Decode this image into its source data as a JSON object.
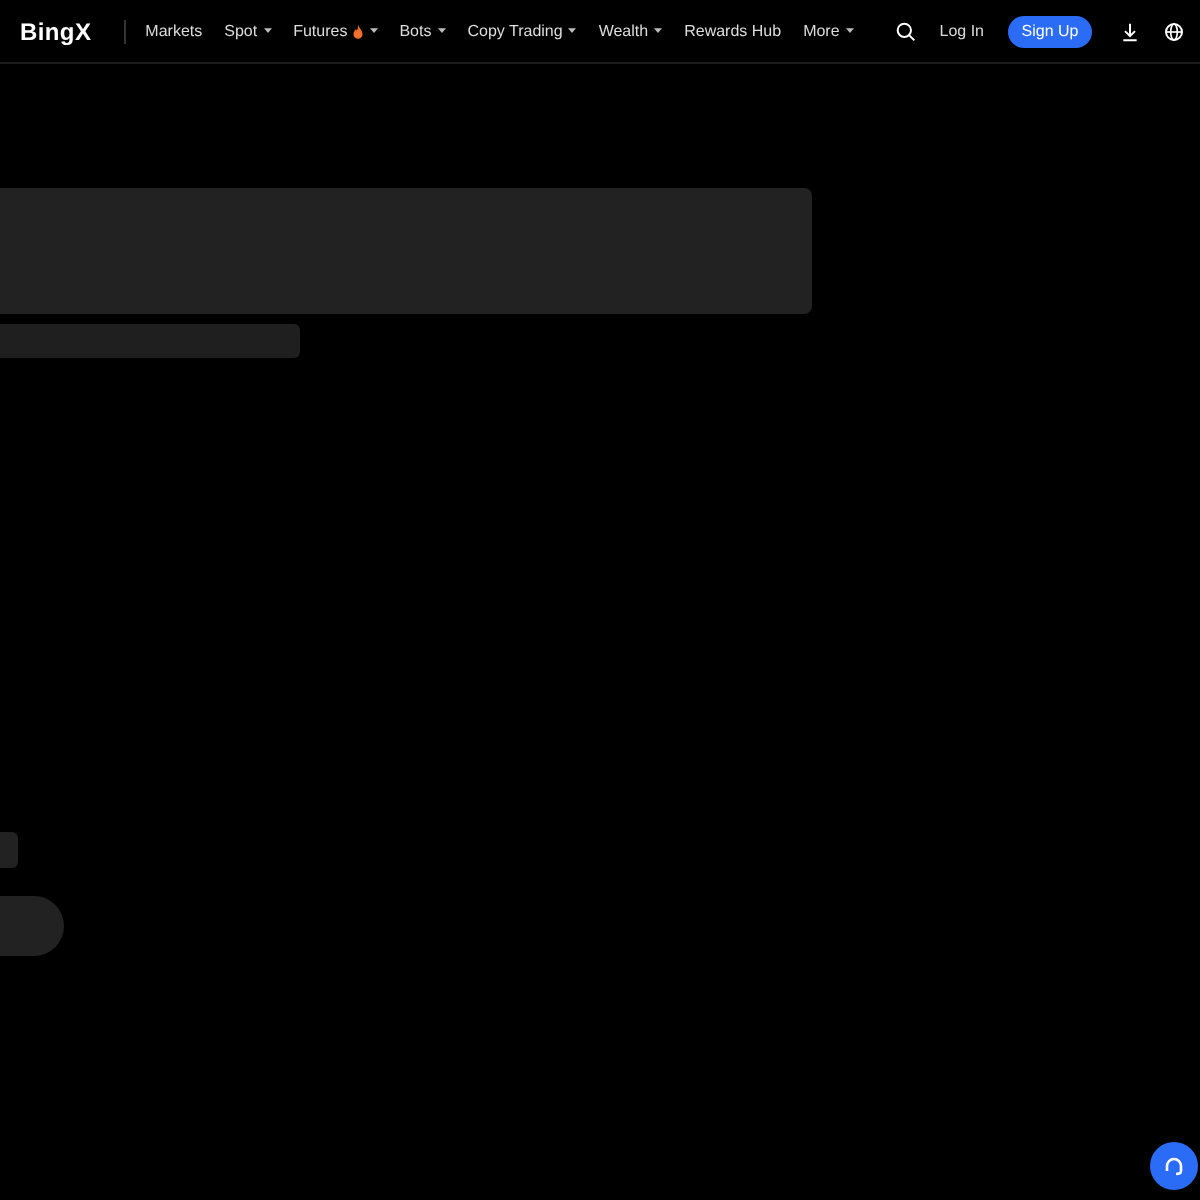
{
  "header": {
    "logo": "BingX",
    "nav": [
      {
        "label": "Markets",
        "kind": "link",
        "hot": false
      },
      {
        "label": "Spot",
        "kind": "dropdown",
        "hot": false
      },
      {
        "label": "Futures",
        "kind": "dropdown",
        "hot": true
      },
      {
        "label": "Bots",
        "kind": "dropdown",
        "hot": false
      },
      {
        "label": "Copy Trading",
        "kind": "dropdown",
        "hot": false
      },
      {
        "label": "Wealth",
        "kind": "dropdown",
        "hot": false
      },
      {
        "label": "Rewards Hub",
        "kind": "link",
        "hot": false
      },
      {
        "label": "More",
        "kind": "dropdown",
        "hot": false
      }
    ],
    "login": "Log In",
    "signup": "Sign Up"
  },
  "placeholders": [
    {
      "kind": "block"
    },
    {
      "kind": "line"
    },
    {
      "kind": "chip"
    },
    {
      "kind": "pill"
    }
  ]
}
